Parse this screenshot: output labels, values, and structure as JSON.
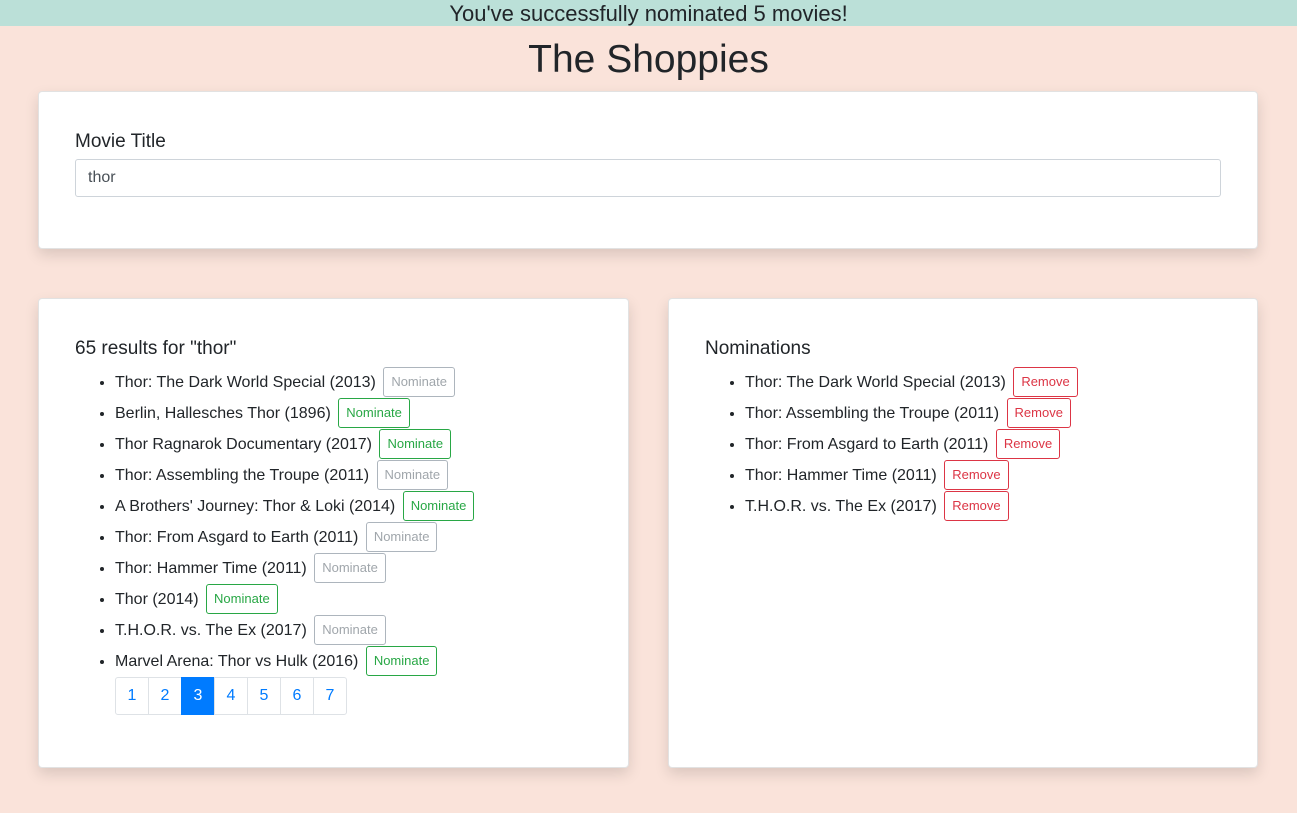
{
  "banner": {
    "text": "You've successfully nominated 5 movies!"
  },
  "app": {
    "title": "The Shoppies"
  },
  "search": {
    "label": "Movie Title",
    "value": "thor"
  },
  "results": {
    "heading": "65 results for \"thor\"",
    "items": [
      {
        "title": "Thor: The Dark World Special (2013)",
        "button": "Nominate",
        "disabled": true
      },
      {
        "title": "Berlin, Hallesches Thor (1896)",
        "button": "Nominate",
        "disabled": false
      },
      {
        "title": "Thor Ragnarok Documentary (2017)",
        "button": "Nominate",
        "disabled": false
      },
      {
        "title": "Thor: Assembling the Troupe (2011)",
        "button": "Nominate",
        "disabled": true
      },
      {
        "title": "A Brothers' Journey: Thor & Loki (2014)",
        "button": "Nominate",
        "disabled": false
      },
      {
        "title": "Thor: From Asgard to Earth (2011)",
        "button": "Nominate",
        "disabled": true
      },
      {
        "title": "Thor: Hammer Time (2011)",
        "button": "Nominate",
        "disabled": true
      },
      {
        "title": "Thor (2014)",
        "button": "Nominate",
        "disabled": false
      },
      {
        "title": "T.H.O.R. vs. The Ex (2017)",
        "button": "Nominate",
        "disabled": true
      },
      {
        "title": "Marvel Arena: Thor vs Hulk (2016)",
        "button": "Nominate",
        "disabled": false
      }
    ],
    "pages": [
      "1",
      "2",
      "3",
      "4",
      "5",
      "6",
      "7"
    ],
    "current_page": "3"
  },
  "nominations": {
    "heading": "Nominations",
    "items": [
      {
        "title": "Thor: The Dark World Special (2013)",
        "button": "Remove"
      },
      {
        "title": "Thor: Assembling the Troupe (2011)",
        "button": "Remove"
      },
      {
        "title": "Thor: From Asgard to Earth (2011)",
        "button": "Remove"
      },
      {
        "title": "Thor: Hammer Time (2011)",
        "button": "Remove"
      },
      {
        "title": "T.H.O.R. vs. The Ex (2017)",
        "button": "Remove"
      }
    ]
  },
  "colors": {
    "background": "#fae3da",
    "banner": "#bbe0d8",
    "nominate": "#28a745",
    "remove": "#dc3545",
    "primary": "#007bff"
  }
}
